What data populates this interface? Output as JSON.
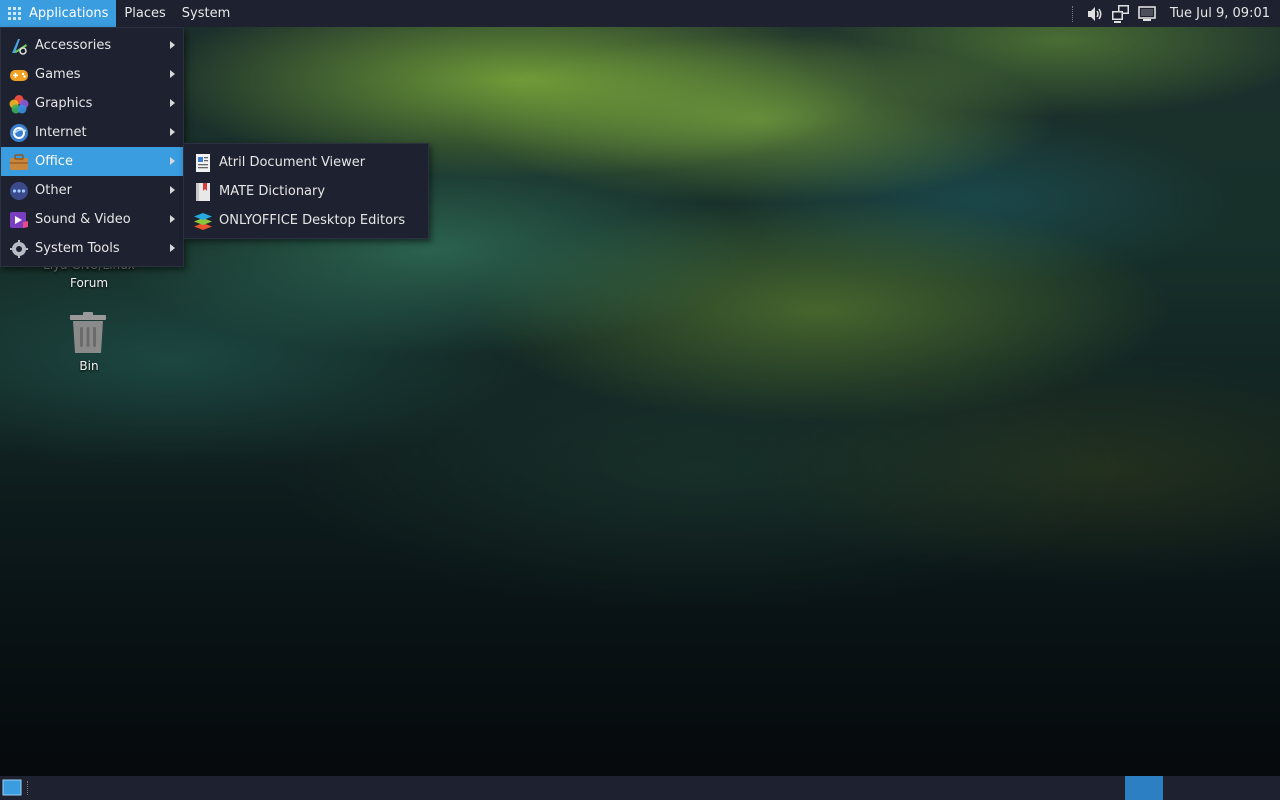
{
  "top_panel": {
    "menus": [
      {
        "label": "Applications"
      },
      {
        "label": "Places"
      },
      {
        "label": "System"
      }
    ],
    "clock": "Tue Jul  9, 09:01",
    "tray_icons": [
      "volume-icon",
      "network-icon",
      "display-icon"
    ]
  },
  "apps_menu": {
    "items": [
      {
        "label": "Accessories",
        "icon": "accessories-icon"
      },
      {
        "label": "Games",
        "icon": "games-icon"
      },
      {
        "label": "Graphics",
        "icon": "graphics-icon"
      },
      {
        "label": "Internet",
        "icon": "internet-icon"
      },
      {
        "label": "Office",
        "icon": "office-icon",
        "active": true
      },
      {
        "label": "Other",
        "icon": "other-icon"
      },
      {
        "label": "Sound & Video",
        "icon": "sound-video-icon"
      },
      {
        "label": "System Tools",
        "icon": "system-tools-icon"
      }
    ]
  },
  "office_submenu": {
    "items": [
      {
        "label": "Atril Document Viewer",
        "icon": "atril-icon"
      },
      {
        "label": "MATE Dictionary",
        "icon": "dictionary-icon"
      },
      {
        "label": "ONLYOFFICE Desktop Editors",
        "icon": "onlyoffice-icon"
      }
    ]
  },
  "desktop": {
    "forum_label_line1": "Liya GNU/Linux",
    "forum_label_line2": "Forum",
    "bin_label": "Bin"
  },
  "colors": {
    "panel_bg": "#1e2230",
    "accent": "#3a9de0",
    "workspace": "#2b7fc2"
  }
}
